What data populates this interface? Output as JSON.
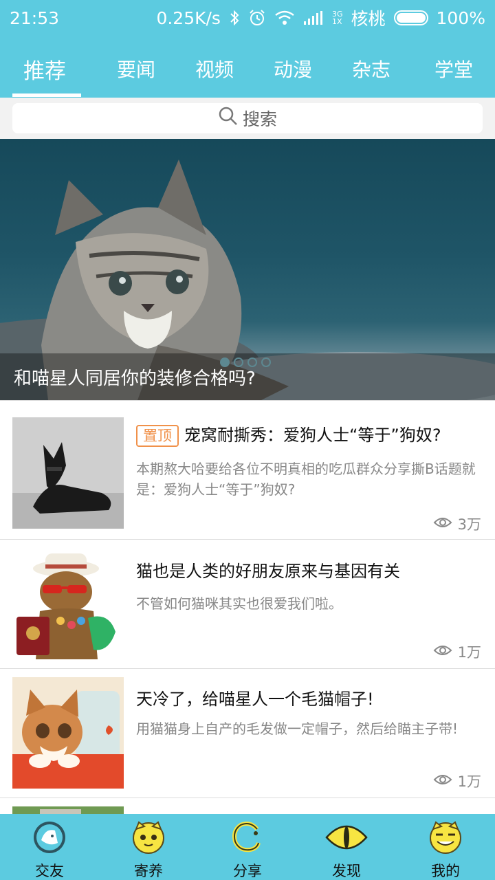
{
  "status_bar": {
    "time": "21:53",
    "speed": "0.25K/s",
    "net_top": "3G",
    "net_bottom": "1X",
    "carrier": "核桃",
    "battery": "100%"
  },
  "tabs": [
    {
      "label": "推荐",
      "active": true
    },
    {
      "label": "要闻"
    },
    {
      "label": "视频"
    },
    {
      "label": "动漫"
    },
    {
      "label": "杂志"
    },
    {
      "label": "学堂"
    }
  ],
  "search": {
    "placeholder": "搜索"
  },
  "banner": {
    "caption": "和喵星人同居你的装修合格吗?",
    "dots": 4,
    "active_dot": 0
  },
  "articles": [
    {
      "badge": "置顶",
      "title": "宠窝耐撕秀：爱狗人士“等于”狗奴?",
      "desc": "本期熬大哈要给各位不明真相的吃瓜群众分享撕B话题就是：爱狗人士“等于”狗奴?",
      "views": "3万"
    },
    {
      "title": "猫也是人类的好朋友原来与基因有关",
      "desc": "不管如何猫咪其实也很爱我们啦。",
      "views": "1万"
    },
    {
      "title": "天冷了，给喵星人一个毛猫帽子!",
      "desc": "用猫猫身上自产的毛发做一定帽子，然后给瞄主子带!",
      "views": "1万"
    }
  ],
  "bottom_nav": [
    {
      "label": "交友",
      "icon": "friends-icon"
    },
    {
      "label": "寄养",
      "icon": "foster-icon"
    },
    {
      "label": "分享",
      "icon": "share-icon"
    },
    {
      "label": "发现",
      "icon": "discover-icon"
    },
    {
      "label": "我的",
      "icon": "profile-icon"
    }
  ],
  "colors": {
    "accent": "#5ccbe0",
    "badge": "#f0914a"
  }
}
